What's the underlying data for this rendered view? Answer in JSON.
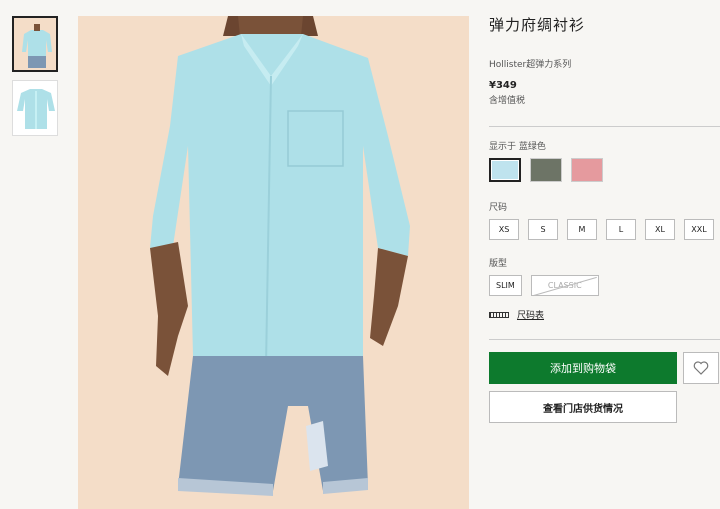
{
  "product": {
    "title": "弹力府绸衬衫",
    "subtitle": "Hollister超弹力系列",
    "price": "¥349",
    "tax_note": "含增值税"
  },
  "thumbnails": [
    {
      "name": "thumbnail-model",
      "active": true
    },
    {
      "name": "thumbnail-flat",
      "active": false
    }
  ],
  "color": {
    "label": "显示于 蓝绿色",
    "swatches": [
      {
        "name": "swatch-light-blue",
        "color": "#bfe3ee",
        "selected": true
      },
      {
        "name": "swatch-olive",
        "color": "#6d7466",
        "selected": false
      },
      {
        "name": "swatch-pink",
        "color": "#e59a9e",
        "selected": false
      }
    ]
  },
  "size": {
    "label": "尺码",
    "options": [
      "XS",
      "S",
      "M",
      "L",
      "XL",
      "XXL"
    ]
  },
  "fit": {
    "label": "版型",
    "options": [
      {
        "label": "SLIM",
        "disabled": false
      },
      {
        "label": "CLASSIC",
        "disabled": true
      }
    ]
  },
  "size_chart_label": "尺码表",
  "actions": {
    "add_to_bag": "添加到购物袋",
    "store_availability": "查看门店供货情况"
  },
  "colors": {
    "accent_green": "#0d7a2d",
    "shirt": "#aee0e8",
    "denim": "#7d97b3"
  },
  "icons": [
    "heart-icon",
    "ruler-icon"
  ]
}
